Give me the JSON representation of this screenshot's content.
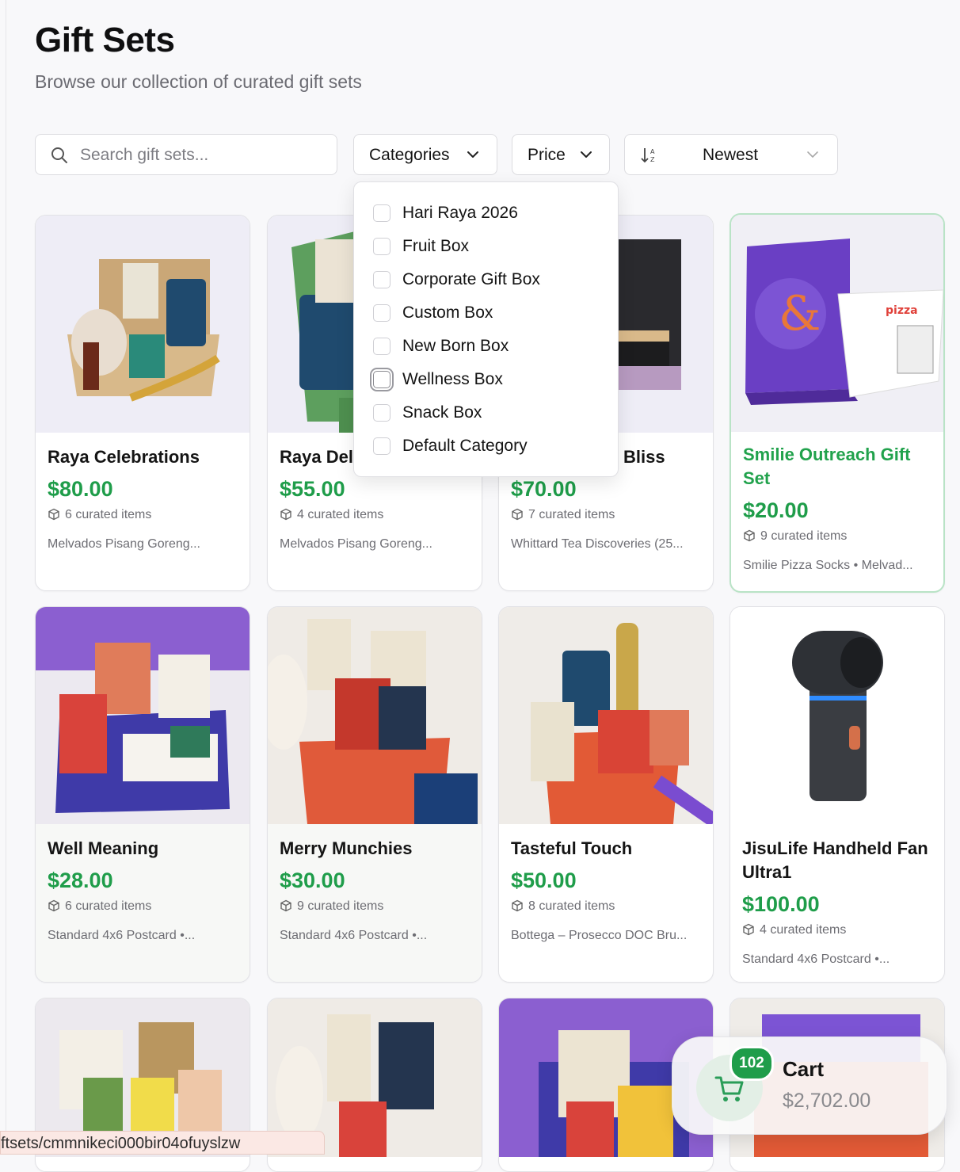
{
  "header": {
    "title": "Gift Sets",
    "subtitle": "Browse our collection of curated gift sets"
  },
  "filters": {
    "search_placeholder": "Search gift sets...",
    "categories_label": "Categories",
    "price_label": "Price",
    "sort_label": "Newest"
  },
  "categories_menu": [
    {
      "label": "Hari Raya 2026",
      "checked": false
    },
    {
      "label": "Fruit Box",
      "checked": false
    },
    {
      "label": "Corporate Gift Box",
      "checked": false
    },
    {
      "label": "Custom Box",
      "checked": false
    },
    {
      "label": "New Born Box",
      "checked": false
    },
    {
      "label": "Wellness Box",
      "checked": false
    },
    {
      "label": "Snack Box",
      "checked": false
    },
    {
      "label": "Default Category",
      "checked": false
    }
  ],
  "products": [
    {
      "title": "Raya Celebrations",
      "price": "$80.00",
      "items": "6 curated items",
      "desc": "Melvados Pisang Goreng..."
    },
    {
      "title": "Raya Del",
      "price": "$55.00",
      "items": "4 curated items",
      "desc": "Melvados Pisang Goreng..."
    },
    {
      "title": "Bliss",
      "price": "$70.00",
      "items": "7 curated items",
      "desc": "Whittard Tea Discoveries (25..."
    },
    {
      "title": "Smilie Outreach Gift Set",
      "price": "$20.00",
      "items": "9 curated items",
      "desc": "Smilie Pizza Socks • Melvad..."
    },
    {
      "title": "Well Meaning",
      "price": "$28.00",
      "items": "6 curated items",
      "desc": "Standard 4x6 Postcard •..."
    },
    {
      "title": "Merry Munchies",
      "price": "$30.00",
      "items": "9 curated items",
      "desc": "Standard 4x6 Postcard •..."
    },
    {
      "title": "Tasteful Touch",
      "price": "$50.00",
      "items": "8 curated items",
      "desc": "Bottega – Prosecco DOC Bru..."
    },
    {
      "title": "JisuLife Handheld Fan Ultra1",
      "price": "$100.00",
      "items": "4 curated items",
      "desc": "Standard 4x6 Postcard •..."
    }
  ],
  "cart": {
    "count": "102",
    "label": "Cart",
    "total": "$2,702.00"
  },
  "status_url": "ftsets/cmmnikeci000bir04ofuyslzw",
  "colors": {
    "accent_green": "#1f9d4a",
    "selected_border": "#b9e3c6",
    "muted_text": "#6d6d73"
  }
}
